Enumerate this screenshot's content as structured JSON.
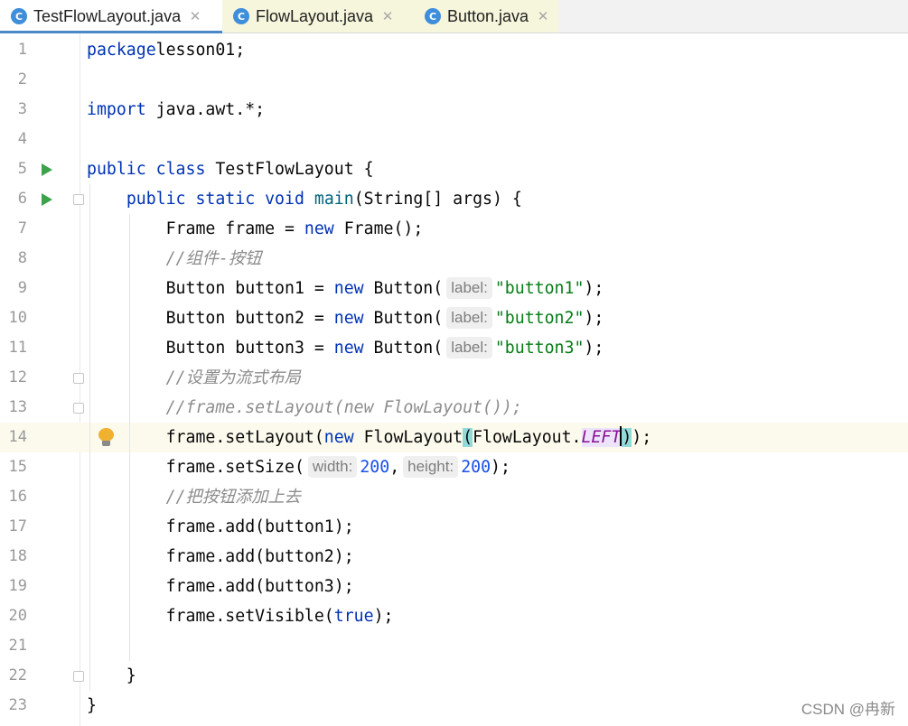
{
  "tabs": [
    {
      "name": "TestFlowLayout.java",
      "icon": "java-class-runnable-icon",
      "active": true
    },
    {
      "name": "FlowLayout.java",
      "icon": "java-class-icon",
      "active": false
    },
    {
      "name": "Button.java",
      "icon": "java-class-icon",
      "active": false
    }
  ],
  "tab_icon_letter": "C",
  "lines": [
    {
      "n": "1",
      "tokens": [
        [
          "kw",
          "package"
        ],
        [
          "",
          "lesson01;"
        ]
      ]
    },
    {
      "n": "2",
      "tokens": []
    },
    {
      "n": "3",
      "tokens": [
        [
          "kw",
          "import"
        ],
        [
          "",
          " java.awt.*;"
        ]
      ]
    },
    {
      "n": "4",
      "tokens": []
    },
    {
      "n": "5",
      "run": true,
      "tokens": [
        [
          "kw",
          "public class"
        ],
        [
          "",
          " TestFlowLayout {"
        ]
      ]
    },
    {
      "n": "6",
      "run": true,
      "fold": true,
      "tokens": [
        [
          "",
          "    "
        ],
        [
          "kw",
          "public static void"
        ],
        [
          "",
          " "
        ],
        [
          "fn",
          "main"
        ],
        [
          "",
          "(String[] args) {"
        ]
      ]
    },
    {
      "n": "7",
      "tokens": [
        [
          "",
          "        Frame frame = "
        ],
        [
          "kw",
          "new"
        ],
        [
          "",
          " Frame();"
        ]
      ]
    },
    {
      "n": "8",
      "tokens": [
        [
          "",
          "        "
        ],
        [
          "cm",
          "//组件-按钮"
        ]
      ]
    },
    {
      "n": "9",
      "tokens": [
        [
          "",
          "        Button button1 = "
        ],
        [
          "kw",
          "new"
        ],
        [
          "",
          " Button("
        ],
        [
          "hint",
          "label:"
        ],
        [
          "str",
          "\"button1\""
        ],
        [
          "",
          ");"
        ]
      ]
    },
    {
      "n": "10",
      "tokens": [
        [
          "",
          "        Button button2 = "
        ],
        [
          "kw",
          "new"
        ],
        [
          "",
          " Button("
        ],
        [
          "hint",
          "label:"
        ],
        [
          "str",
          "\"button2\""
        ],
        [
          "",
          ");"
        ]
      ]
    },
    {
      "n": "11",
      "tokens": [
        [
          "",
          "        Button button3 = "
        ],
        [
          "kw",
          "new"
        ],
        [
          "",
          " Button("
        ],
        [
          "hint",
          "label:"
        ],
        [
          "str",
          "\"button3\""
        ],
        [
          "",
          ");"
        ]
      ]
    },
    {
      "n": "12",
      "fold": true,
      "tokens": [
        [
          "",
          "        "
        ],
        [
          "cm",
          "//设置为流式布局"
        ]
      ]
    },
    {
      "n": "13",
      "fold": true,
      "tokens": [
        [
          "",
          "        "
        ],
        [
          "cm",
          "//frame.setLayout(new FlowLayout());"
        ]
      ]
    },
    {
      "n": "14",
      "current": true,
      "bulb": true,
      "tokens": [
        [
          "",
          "        frame.setLayout("
        ],
        [
          "kw",
          "new"
        ],
        [
          "",
          " FlowLayout"
        ],
        [
          "brace",
          "("
        ],
        [
          "",
          "FlowLayout."
        ],
        [
          "const",
          "LEFT"
        ],
        [
          "caret",
          ""
        ],
        [
          "brace",
          ")"
        ],
        [
          "",
          ");"
        ]
      ]
    },
    {
      "n": "15",
      "tokens": [
        [
          "",
          "        frame.setSize("
        ],
        [
          "hint",
          "width:"
        ],
        [
          "num",
          "200"
        ],
        [
          "",
          ","
        ],
        [
          "hint",
          "height:"
        ],
        [
          "num",
          "200"
        ],
        [
          "",
          ");"
        ]
      ]
    },
    {
      "n": "16",
      "tokens": [
        [
          "",
          "        "
        ],
        [
          "cm",
          "//把按钮添加上去"
        ]
      ]
    },
    {
      "n": "17",
      "tokens": [
        [
          "",
          "        frame.add(button1);"
        ]
      ]
    },
    {
      "n": "18",
      "tokens": [
        [
          "",
          "        frame.add(button2);"
        ]
      ]
    },
    {
      "n": "19",
      "tokens": [
        [
          "",
          "        frame.add(button3);"
        ]
      ]
    },
    {
      "n": "20",
      "tokens": [
        [
          "",
          "        frame.setVisible("
        ],
        [
          "kw",
          "true"
        ],
        [
          "",
          ");"
        ]
      ]
    },
    {
      "n": "21",
      "tokens": []
    },
    {
      "n": "22",
      "fold": true,
      "tokens": [
        [
          "",
          "    }"
        ]
      ]
    },
    {
      "n": "23",
      "tokens": [
        [
          "",
          "}"
        ]
      ]
    }
  ],
  "watermark": "CSDN @冉新"
}
